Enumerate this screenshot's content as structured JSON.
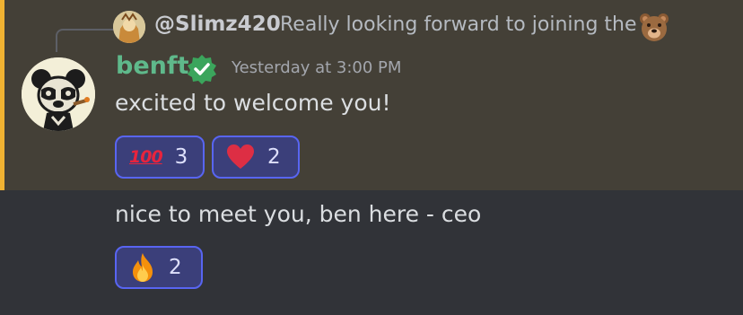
{
  "reply": {
    "username": "@Slimz420",
    "text": "Really looking forward to joining the",
    "emoji_icon": "bear-face-icon"
  },
  "message": {
    "username": "benft",
    "verified_icon": "verified-badge-icon",
    "timestamp": "Yesterday at 3:00 PM",
    "lines": [
      "excited to welcome you!",
      "nice to meet you, ben here - ceo"
    ]
  },
  "reactions_first": [
    {
      "emoji": "hundred-points-icon",
      "glyph": "100",
      "count": "3"
    },
    {
      "emoji": "red-heart-icon",
      "count": "2"
    }
  ],
  "reactions_second": [
    {
      "emoji": "fire-icon",
      "count": "2"
    }
  ],
  "colors": {
    "highlight_bg": "#444037",
    "highlight_bar": "#f0b232",
    "username": "#5fb98b",
    "reaction_border": "#5865f2",
    "reaction_bg": "#3b3f7a"
  }
}
